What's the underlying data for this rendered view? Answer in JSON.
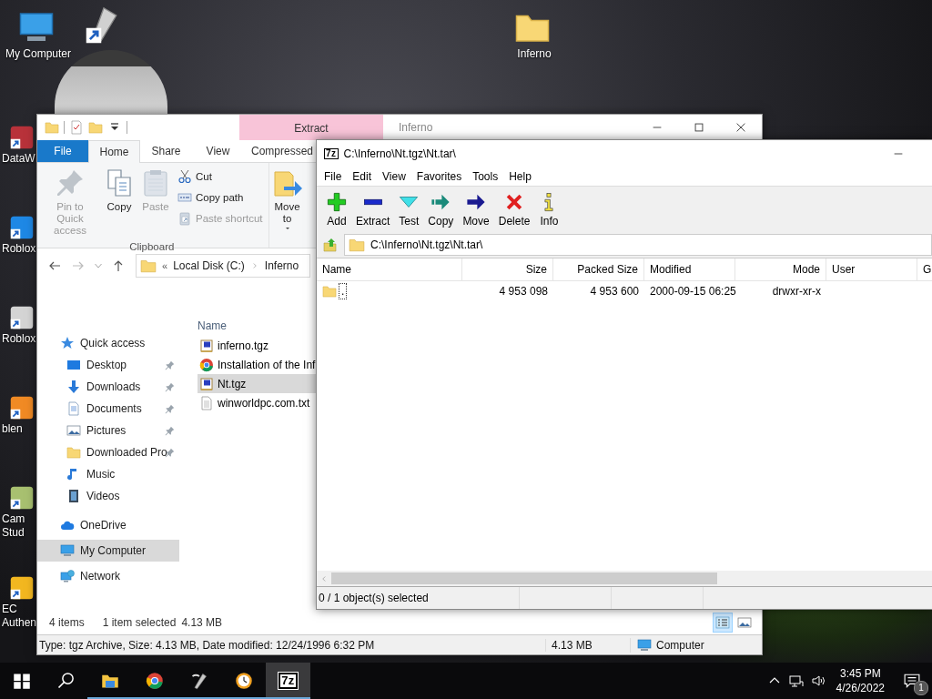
{
  "desktop": {
    "icons": [
      {
        "label": "My Computer",
        "kind": "computer"
      },
      {
        "label": "DataW",
        "kind": "shortcut",
        "color": "#b8323a"
      },
      {
        "label": "Roblox",
        "kind": "shortcut",
        "color": "#1e88e5"
      },
      {
        "label": "Roblox",
        "kind": "shortcut",
        "color": "#d4d4d4"
      },
      {
        "label": "blen",
        "kind": "shortcut",
        "color": "#f08a24"
      },
      {
        "label": "Cam Stud",
        "kind": "shortcut",
        "color": "#a8c070"
      },
      {
        "label": "EC Authen",
        "kind": "shortcut",
        "color": "#f2b720"
      }
    ],
    "folder_icon": {
      "label": "Inferno"
    }
  },
  "explorer": {
    "context_tab": "Extract",
    "title": "Inferno",
    "ribbon_tabs": [
      {
        "label": "File",
        "kind": "file",
        "selected": false
      },
      {
        "label": "Home",
        "kind": "tab",
        "selected": true
      },
      {
        "label": "Share",
        "kind": "tab",
        "selected": false
      },
      {
        "label": "View",
        "kind": "tab",
        "selected": false
      },
      {
        "label": "Compressed",
        "kind": "tab",
        "selected": false
      }
    ],
    "clipboard_group": {
      "label": "Clipboard",
      "large_buttons": [
        {
          "label": "Pin to Quick access",
          "kind": "pin",
          "disabled": true
        },
        {
          "label": "Copy",
          "kind": "copy",
          "disabled": false
        },
        {
          "label": "Paste",
          "kind": "paste",
          "disabled": true
        }
      ],
      "small_buttons": [
        {
          "label": "Cut",
          "kind": "cut",
          "disabled": false
        },
        {
          "label": "Copy path",
          "kind": "copypath",
          "disabled": false
        },
        {
          "label": "Paste shortcut",
          "kind": "pasteshortcut",
          "disabled": true
        }
      ]
    },
    "move_to": {
      "label": "Move to"
    },
    "address": {
      "overflow": "«",
      "crumbs": [
        "Local Disk (C:)",
        "Inferno"
      ]
    },
    "nav_pane": [
      {
        "label": "Quick access",
        "kind": "star",
        "selected": false,
        "children": [
          {
            "label": "Desktop",
            "kind": "desktop",
            "pinned": true,
            "selected": false
          },
          {
            "label": "Downloads",
            "kind": "download",
            "pinned": true,
            "selected": false
          },
          {
            "label": "Documents",
            "kind": "document",
            "pinned": true,
            "selected": false
          },
          {
            "label": "Pictures",
            "kind": "picture",
            "pinned": true,
            "selected": false
          },
          {
            "label": "Downloaded Pro",
            "kind": "folder",
            "pinned": true,
            "selected": false
          },
          {
            "label": "Music",
            "kind": "music",
            "pinned": false,
            "selected": false
          },
          {
            "label": "Videos",
            "kind": "video",
            "pinned": false,
            "selected": false
          }
        ]
      },
      {
        "label": "OneDrive",
        "kind": "cloud",
        "selected": false
      },
      {
        "label": "My Computer",
        "kind": "computer",
        "selected": true
      },
      {
        "label": "Network",
        "kind": "network",
        "selected": false
      }
    ],
    "files": {
      "column": "Name",
      "rows": [
        {
          "name": "inferno.tgz",
          "kind": "archive",
          "selected": false
        },
        {
          "name": "Installation of the Inf",
          "kind": "chrome",
          "selected": false
        },
        {
          "name": "Nt.tgz",
          "kind": "archive",
          "selected": true
        },
        {
          "name": "winworldpc.com.txt",
          "kind": "text",
          "selected": false
        }
      ]
    },
    "status": {
      "items": "4 items",
      "selection": "1 item selected",
      "selection_size": "4.13 MB"
    },
    "view_buttons": [
      {
        "kind": "details",
        "selected": true
      },
      {
        "kind": "large",
        "selected": false
      }
    ],
    "details_bar": {
      "info": "Type: tgz Archive, Size: 4.13 MB, Date modified: 12/24/1996 6:32 PM",
      "size": "4.13 MB",
      "location": "Computer"
    }
  },
  "sevenzip": {
    "app_icon": "7z",
    "title": "C:\\Inferno\\Nt.tgz\\Nt.tar\\",
    "menu": [
      "File",
      "Edit",
      "View",
      "Favorites",
      "Tools",
      "Help"
    ],
    "toolbar": [
      {
        "label": "Add",
        "kind": "add"
      },
      {
        "label": "Extract",
        "kind": "extract"
      },
      {
        "label": "Test",
        "kind": "test"
      },
      {
        "label": "Copy",
        "kind": "copy"
      },
      {
        "label": "Move",
        "kind": "move"
      },
      {
        "label": "Delete",
        "kind": "delete"
      },
      {
        "label": "Info",
        "kind": "info"
      }
    ],
    "path": "C:\\Inferno\\Nt.tgz\\Nt.tar\\",
    "columns": [
      "Name",
      "Size",
      "Packed Size",
      "Modified",
      "Mode",
      "User",
      "G"
    ],
    "rows": [
      {
        "name": ".",
        "size": "4 953 098",
        "packed_size": "4 953 600",
        "modified": "2000-09-15 06:25",
        "mode": "drwxr-xr-x",
        "selected": false
      }
    ],
    "status": "0 / 1 object(s) selected"
  },
  "taskbar": {
    "apps": [
      {
        "kind": "explorer",
        "selected": false
      },
      {
        "kind": "chrome",
        "selected": false
      },
      {
        "kind": "remote",
        "selected": false
      },
      {
        "kind": "clock",
        "selected": false
      },
      {
        "kind": "sevenzip",
        "label": "7z",
        "selected": true
      }
    ],
    "time": "3:45 PM",
    "date": "4/26/2022",
    "notification_count": "1"
  }
}
